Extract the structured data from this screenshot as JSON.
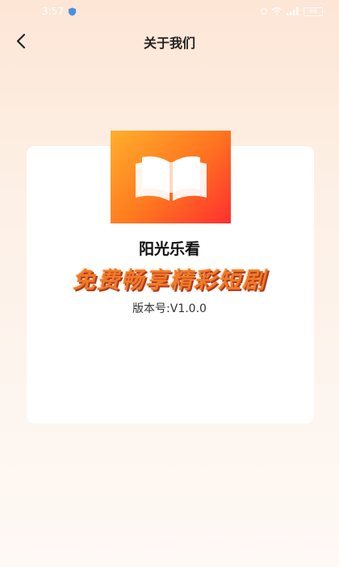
{
  "status_bar": {
    "time": "3:57",
    "battery": "89"
  },
  "nav": {
    "title": "关于我们"
  },
  "app": {
    "name": "阳光乐看",
    "slogan": "免费畅享精彩短剧",
    "version": "版本号:V1.0.0"
  },
  "colors": {
    "logo_gradient_start": "#ffae2d",
    "logo_gradient_end": "#ff2f2f",
    "slogan": "#f07a28",
    "card": "#ffffff"
  },
  "icons": {
    "back": "chevron-left-icon",
    "logo": "open-book-icon"
  }
}
